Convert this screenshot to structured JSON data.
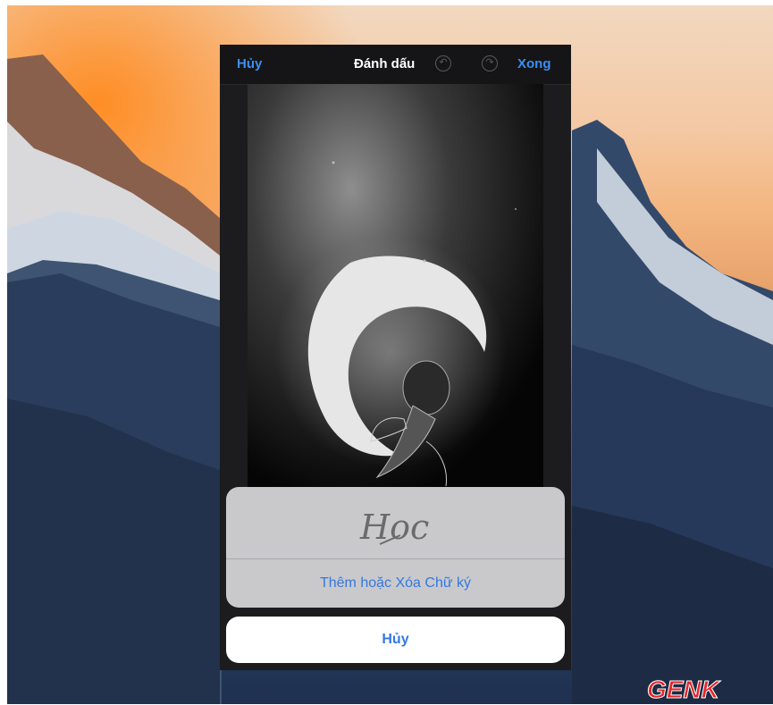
{
  "navbar": {
    "cancel_label": "Hủy",
    "title": "Đánh dấu",
    "undo_icon": "undo-icon",
    "redo_icon": "redo-icon",
    "done_label": "Xong"
  },
  "signature_sheet": {
    "signature_text": "Hoc",
    "action_label": "Thêm hoặc Xóa Chữ ký"
  },
  "cancel_sheet": {
    "label": "Hủy"
  },
  "watermark": {
    "logo_text": "GENK"
  },
  "colors": {
    "accent": "#3b8ef5",
    "sheet_bg": "#c9c9cc",
    "nav_bg": "#151517"
  }
}
